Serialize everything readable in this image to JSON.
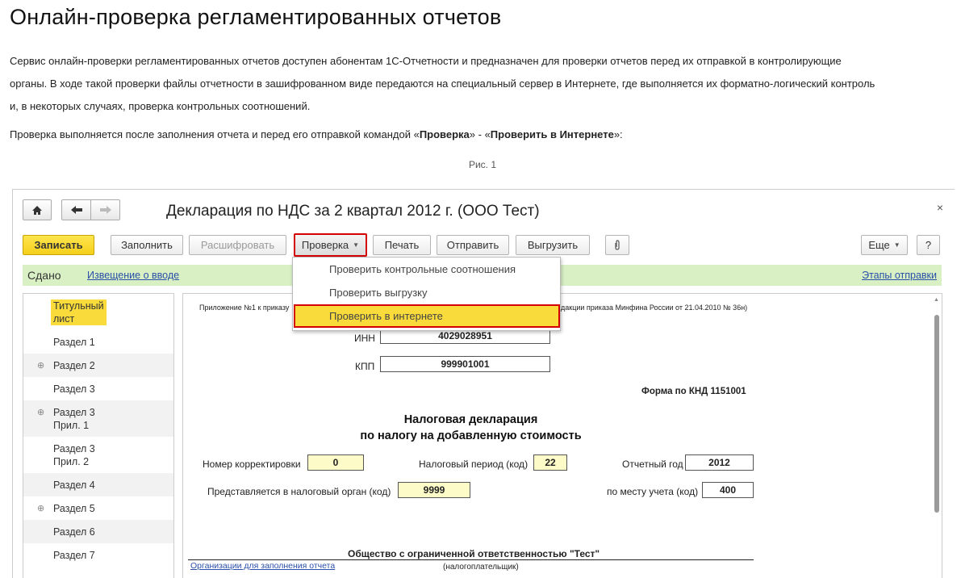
{
  "article": {
    "title": "Онлайн-проверка регламентированных отчетов",
    "para1_line1": "Сервис онлайн-проверки регламентированных отчетов доступен абонентам 1С-Отчетности и предназначен для проверки отчетов перед их отправкой в контролирующие",
    "para1_line2": "органы. В ходе такой проверки файлы отчетности в зашифрованном виде передаются на специальный сервер в Интернете, где выполняется их форматно-логический контроль",
    "para1_line3": "и, в некоторых случаях, проверка контрольных соотношений.",
    "para2_prefix": "Проверка выполняется после заполнения отчета и перед его отправкой командой «",
    "para2_bold1": "Проверка",
    "para2_mid": "» - «",
    "para2_bold2": "Проверить в Интернете",
    "para2_suffix": "»:",
    "caption": "Рис. 1"
  },
  "window": {
    "title": "Декларация по НДС за 2 квартал 2012 г. (ООО Тест)",
    "close": "×",
    "nav": {
      "home_icon": "home-icon",
      "back_icon": "arrow-left-icon",
      "forward_icon": "arrow-right-icon"
    }
  },
  "toolbar": {
    "save": "Записать",
    "fill": "Заполнить",
    "decode": "Расшифровать",
    "check": "Проверка",
    "print": "Печать",
    "send": "Отправить",
    "export": "Выгрузить",
    "attach_icon": "paperclip-icon",
    "more": "Еще",
    "help": "?"
  },
  "dropdown": {
    "items": [
      "Проверить контрольные соотношения",
      "Проверить выгрузку",
      "Проверить в интернете"
    ]
  },
  "status": {
    "text": "Сдано",
    "link_left": "Извещение о вводе",
    "link_right": "Этапы отправки"
  },
  "sidebar": {
    "items": [
      {
        "l1": "Титульный",
        "l2": "лист"
      },
      {
        "l1": "Раздел 1",
        "l2": ""
      },
      {
        "l1": "Раздел 2",
        "l2": ""
      },
      {
        "l1": "Раздел 3",
        "l2": ""
      },
      {
        "l1": "Раздел 3",
        "l2": "Прил. 1"
      },
      {
        "l1": "Раздел 3",
        "l2": "Прил. 2"
      },
      {
        "l1": "Раздел 4",
        "l2": ""
      },
      {
        "l1": "Раздел 5",
        "l2": ""
      },
      {
        "l1": "Раздел 6",
        "l2": ""
      },
      {
        "l1": "Раздел 7",
        "l2": ""
      }
    ]
  },
  "doc": {
    "appendix_left": "Приложение №1 к приказу",
    "appendix_right": "дакции приказа Минфина России от 21.04.2010 № 36н)",
    "inn_label": "ИНН",
    "inn": "4029028951",
    "kpp_label": "КПП",
    "kpp": "999901001",
    "form_code": "Форма по КНД 1151001",
    "heading1": "Налоговая декларация",
    "heading2": "по налогу на добавленную стоимость",
    "corr_label": "Номер корректировки",
    "corr": "0",
    "period_label": "Налоговый период (код)",
    "period": "22",
    "year_label": "Отчетный год",
    "year": "2012",
    "organ_label": "Представляется в налоговый орган (код)",
    "organ": "9999",
    "place_label": "по месту учета (код)",
    "place": "400",
    "org_name": "Общество с ограниченной ответственностью \"Тест\"",
    "org_link": "Организации для заполнения отчета",
    "taxpayer": "(налогоплательщик)"
  }
}
